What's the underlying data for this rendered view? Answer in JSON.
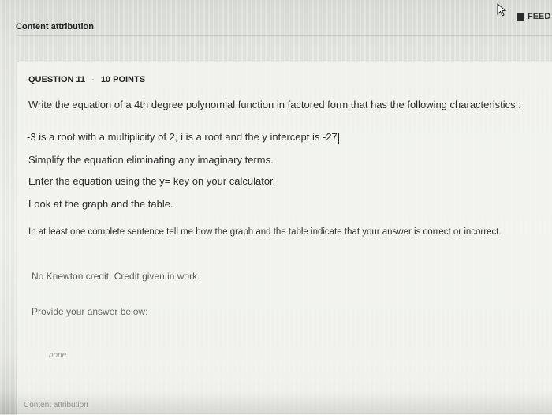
{
  "header": {
    "feedback_label": "FEED",
    "content_attribution": "Content attribution"
  },
  "question": {
    "number": "QUESTION 11",
    "separator": "·",
    "points": "10 POINTS",
    "prompt_line1": "Write the equation of a 4th degree polynomial function in factored form that has the following characteristics::",
    "prompt_line2": "-3 is a root with a multiplicity of 2,  i is a root and the y intercept is -27",
    "prompt_line3": "Simplify the equation eliminating any imaginary terms.",
    "prompt_line4": "Enter the equation using the y= key on your calculator.",
    "prompt_line5": "Look at the graph and the table.",
    "prompt_line6": "In at least one complete sentence tell me how the graph and the table indicate that your answer is correct or incorrect.",
    "note": "No Knewton credit. Credit given in work.",
    "answer_prompt": "Provide your answer below:",
    "answer_value": "none"
  },
  "footer": {
    "content_attribution": "Content attribution"
  },
  "icons": {
    "cursor": "mouse-pointer-icon",
    "feedback": "flag-icon"
  }
}
